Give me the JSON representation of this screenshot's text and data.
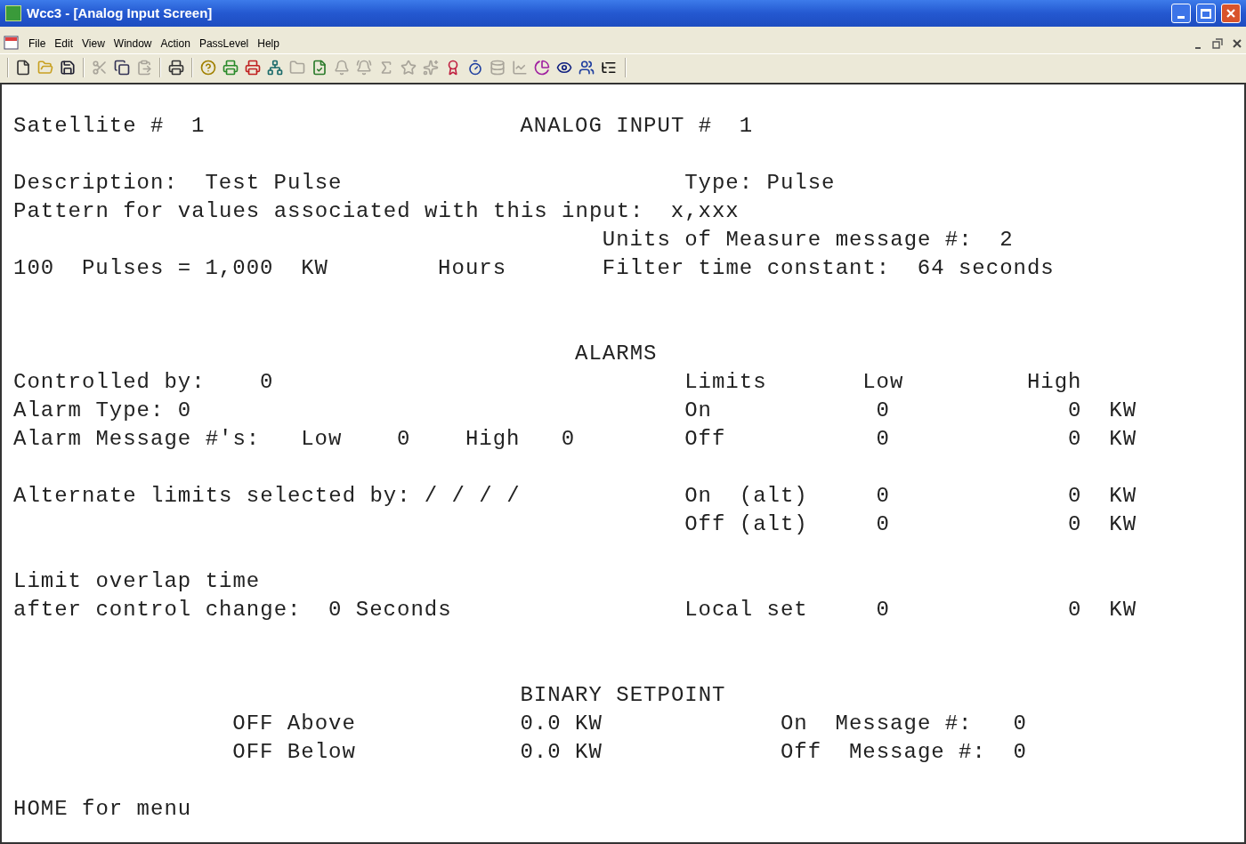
{
  "window": {
    "title": "Wcc3 - [Analog Input Screen]"
  },
  "menu": [
    "File",
    "Edit",
    "View",
    "Window",
    "Action",
    "PassLevel",
    "Help"
  ],
  "toolbar": [
    {
      "disabled": false
    },
    {
      "disabled": false
    },
    {
      "disabled": false
    },
    {
      "disabled": true
    },
    {
      "disabled": false
    },
    {
      "disabled": true
    },
    {
      "disabled": false
    },
    {
      "disabled": false
    },
    {
      "disabled": false
    },
    {
      "disabled": false
    },
    {
      "disabled": false
    },
    {
      "disabled": true
    },
    {
      "disabled": false
    },
    {
      "disabled": true
    },
    {
      "disabled": true
    },
    {
      "disabled": true
    },
    {
      "disabled": true
    },
    {
      "disabled": true
    },
    {
      "disabled": false
    },
    {
      "disabled": false
    },
    {
      "disabled": true
    },
    {
      "disabled": true
    },
    {
      "disabled": false
    },
    {
      "disabled": false
    },
    {
      "disabled": false
    },
    {
      "disabled": false
    }
  ],
  "screen": {
    "satellite": {
      "label": "Satellite #",
      "value": "1"
    },
    "analog_input": {
      "label": "ANALOG INPUT #",
      "value": "1"
    },
    "description": {
      "label": "Description:",
      "value": "Test Pulse"
    },
    "type": {
      "label": "Type:",
      "value": "Pulse"
    },
    "pattern": {
      "label": "Pattern for values associated with this input:",
      "value": "x,xxx"
    },
    "units_message": {
      "label": "Units of Measure message #:",
      "value": "2"
    },
    "scaling": {
      "pulses": "100",
      "label": "Pulses =",
      "value": "1,000",
      "unit": "KW",
      "period": "Hours"
    },
    "filter": {
      "label": "Filter time constant:",
      "value": "64",
      "unit": "seconds"
    },
    "alarms": {
      "heading": "ALARMS",
      "controlled_by": {
        "label": "Controlled by:",
        "value": "0"
      },
      "alarm_type": {
        "label": "Alarm Type:",
        "value": "0"
      },
      "messages": {
        "label": "Alarm Message #'s:",
        "low_label": "Low",
        "low": "0",
        "high_label": "High",
        "high": "0"
      },
      "alternate": {
        "label": "Alternate limits selected by:",
        "value": "/ / / /"
      },
      "overlap": {
        "label_1": "Limit overlap time",
        "label_2": "after control change:",
        "value": "0",
        "unit": "Seconds"
      },
      "limits": {
        "columns": [
          "Limits",
          "Low",
          "High"
        ],
        "rows": [
          {
            "name": "On",
            "low": "0",
            "high": "0",
            "unit": "KW"
          },
          {
            "name": "Off",
            "low": "0",
            "high": "0",
            "unit": "KW"
          },
          {
            "name": "On  (alt)",
            "low": "0",
            "high": "0",
            "unit": "KW"
          },
          {
            "name": "Off (alt)",
            "low": "0",
            "high": "0",
            "unit": "KW"
          },
          {
            "name": "Local set",
            "low": "0",
            "high": "0",
            "unit": "KW"
          }
        ]
      }
    },
    "binary_setpoint": {
      "heading": "BINARY SETPOINT",
      "rows": [
        {
          "label": "OFF Above",
          "value": "0.0",
          "unit": "KW",
          "message_label": "On  Message #:",
          "message": "0"
        },
        {
          "label": "OFF Below",
          "value": "0.0",
          "unit": "KW",
          "message_label": "Off  Message #:",
          "message": "0"
        }
      ]
    },
    "footer": "HOME for menu"
  }
}
